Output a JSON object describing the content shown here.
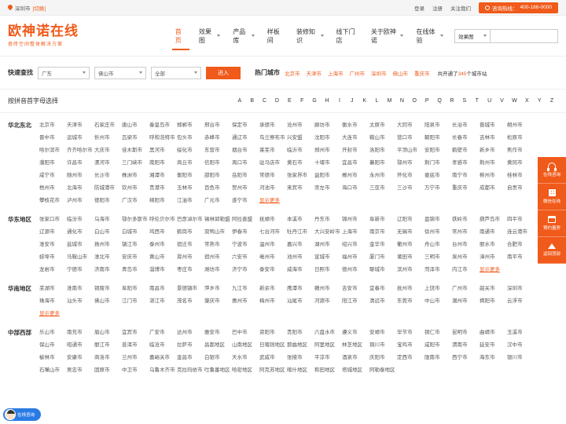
{
  "topbar": {
    "location": "深圳市",
    "switch": "[切换]",
    "login": "登录",
    "register": "注册",
    "follow": "关注我们",
    "hotline_label": "咨询热线：",
    "hotline_number": "400-186-0000"
  },
  "logo": {
    "main": "欧神诺在线",
    "sub": "瓷砖空间整体解决方案"
  },
  "nav": {
    "items": [
      {
        "label": "首页"
      },
      {
        "label": "效果图"
      },
      {
        "label": "产品库"
      },
      {
        "label": "样板间"
      },
      {
        "label": "装修知识"
      },
      {
        "label": "线下门店"
      },
      {
        "label": "关于欧神诺"
      },
      {
        "label": "在线体验"
      }
    ],
    "search_select": "效果图"
  },
  "quick": {
    "label": "快速查找",
    "province": "广东",
    "city": "佛山市",
    "district": "全部",
    "enter": "进入",
    "hot_title": "热门城市",
    "hot_cities": [
      "北京市",
      "天津市",
      "上海市",
      "广州市",
      "深圳市",
      "佛山市",
      "重庆市"
    ],
    "count_prefix": "共开通了",
    "count_num": "345",
    "count_suffix": "个城市站"
  },
  "letters": {
    "label": "按拼音首字母选择",
    "list": [
      "A",
      "B",
      "C",
      "D",
      "E",
      "F",
      "G",
      "H",
      "I",
      "J",
      "K",
      "L",
      "M",
      "N",
      "O",
      "P",
      "Q",
      "R",
      "S",
      "T",
      "U",
      "V",
      "W",
      "X",
      "Y",
      "Z"
    ]
  },
  "regions": [
    {
      "name": "华北东北",
      "cities": [
        "北京市",
        "天津市",
        "石家庄市",
        "唐山市",
        "秦皇岛市",
        "邯郸市",
        "邢台市",
        "保定市",
        "承德市",
        "沧州市",
        "廊坊市",
        "衡水市",
        "太原市",
        "大同市",
        "阳泉市",
        "长治市",
        "晋城市",
        "朔州市",
        "晋中市",
        "运城市",
        "忻州市",
        "吕梁市",
        "呼和浩特市",
        "包头市",
        "赤峰市",
        "通辽市",
        "鸟兰察布市",
        "兴安盟",
        "沈阳市",
        "大连市",
        "鞍山市",
        "营口市",
        "朝阳市",
        "长春市",
        "吉林市",
        "松原市",
        "哈尔滨市",
        "齐齐哈尔市",
        "大庆市",
        "佳木斯市",
        "黑河市",
        "绥化市",
        "东营市",
        "烟台市",
        "莱芜市",
        "临沂市",
        "郑州市",
        "开封市",
        "洛阳市",
        "平顶山市",
        "安阳市",
        "鹤壁市",
        "新乡市",
        "焦作市",
        "濮阳市",
        "许昌市",
        "漯河市",
        "三门峡市",
        "南阳市",
        "商丘市",
        "信阳市",
        "周口市",
        "驻马店市",
        "黄石市",
        "十堰市",
        "宜昌市",
        "襄阳市",
        "鄂州市",
        "荆门市",
        "孝感市",
        "荆州市",
        "黄冈市",
        "咸宁市",
        "随州市",
        "长沙市",
        "株洲市",
        "湘潭市",
        "衡阳市",
        "邵阳市",
        "岳阳市",
        "常德市",
        "张家界市",
        "益阳市",
        "郴州市",
        "永州市",
        "怀化市",
        "娄底市",
        "南宁市",
        "柳州市",
        "桂林市",
        "梧州市",
        "北海市",
        "防城港市",
        "钦州市",
        "贵港市",
        "玉林市",
        "百色市",
        "贺州市",
        "河池市",
        "来宾市",
        "崇左市",
        "海口市",
        "三亚市",
        "三沙市",
        "万宁市",
        "重庆市",
        "成都市",
        "自贡市",
        "攀枝花市",
        "泸州市",
        "德阳市",
        "广汉市",
        "绵阳市",
        "江油市",
        "广元市",
        "遂宁市"
      ],
      "more": "显示更多"
    },
    {
      "name": "华东地区",
      "cities": [
        "张家口市",
        "临汾市",
        "乌海市",
        "鄂尔多斯市",
        "呼伦贝尔市",
        "巴彦淖尔市",
        "锡林郭勒盟",
        "阿拉善盟",
        "抚顺市",
        "本溪市",
        "丹东市",
        "锦州市",
        "阜新市",
        "辽阳市",
        "盘锦市",
        "铁岭市",
        "葫芦岛市",
        "四平市",
        "辽源市",
        "通化市",
        "白山市",
        "白城市",
        "鸡西市",
        "鹤岗市",
        "双鸭山市",
        "伊春市",
        "七台河市",
        "牡丹江市",
        "大兴安岭市",
        "上海市",
        "南京市",
        "无锡市",
        "徐州市",
        "常州市",
        "南通市",
        "连云港市",
        "淮安市",
        "盐城市",
        "扬州市",
        "镇江市",
        "泰州市",
        "宿迁市",
        "常熟市",
        "宁波市",
        "温州市",
        "嘉兴市",
        "湖州市",
        "绍兴市",
        "金华市",
        "衢州市",
        "舟山市",
        "台州市",
        "丽水市",
        "合肥市",
        "蚌埠市",
        "马鞍山市",
        "淮北市",
        "安庆市",
        "黄山市",
        "滁州市",
        "宿州市",
        "六安市",
        "亳州市",
        "池州市",
        "宣城市",
        "福州市",
        "厦门市",
        "莆田市",
        "三明市",
        "泉州市",
        "漳州市",
        "南平市",
        "龙岩市",
        "宁德市",
        "济南市",
        "青岛市",
        "淄博市",
        "枣庄市",
        "潍坊市",
        "济宁市",
        "泰安市",
        "威海市",
        "日照市",
        "德州市",
        "聊城市",
        "滨州市",
        "菏泽市",
        "内江市"
      ],
      "more": "显示更多"
    },
    {
      "name": "华南地区",
      "cities": [
        "芜湖市",
        "淮南市",
        "铜陵市",
        "阜阳市",
        "南昌市",
        "景德镇市",
        "萍乡市",
        "九江市",
        "新余市",
        "鹰潭市",
        "赣州市",
        "吉安市",
        "宜春市",
        "抚州市",
        "上饶市",
        "广州市",
        "韶关市",
        "深圳市",
        "珠海市",
        "汕头市",
        "佛山市",
        "江门市",
        "湛江市",
        "茂名市",
        "肇庆市",
        "惠州市",
        "梅州市",
        "汕尾市",
        "河源市",
        "阳江市",
        "清远市",
        "东莞市",
        "中山市",
        "潮州市",
        "揭阳市",
        "云浮市"
      ],
      "more": "显示更多"
    },
    {
      "name": "中部西部",
      "cities": [
        "乐山市",
        "南充市",
        "眉山市",
        "宜宾市",
        "广安市",
        "达州市",
        "雅安市",
        "巴中市",
        "资阳市",
        "贵阳市",
        "六盘水市",
        "遵义市",
        "安顺市",
        "毕节市",
        "铜仁市",
        "昆明市",
        "曲靖市",
        "玉溪市",
        "保山市",
        "昭通市",
        "丽江市",
        "普洱市",
        "临沧市",
        "拉萨市",
        "昌都地区",
        "山南地区",
        "日喀则地区",
        "那曲地区",
        "阿里地区",
        "林芝地区",
        "铜川市",
        "宝鸡市",
        "咸阳市",
        "渭南市",
        "延安市",
        "汉中市",
        "榆林市",
        "安康市",
        "商洛市",
        "兰州市",
        "嘉峪关市",
        "金昌市",
        "白银市",
        "天水市",
        "武威市",
        "张掖市",
        "平凉市",
        "酒泉市",
        "庆阳市",
        "定西市",
        "陇南市",
        "西宁市",
        "海东市",
        "银川市",
        "石嘴山市",
        "吴忠市",
        "固原市",
        "中卫市",
        "乌鲁木齐市",
        "克拉玛依市",
        "吐鲁番地区",
        "哈密地区",
        "阿克苏地区",
        "喀什地区",
        "和田地区",
        "塔城地区",
        "阿勒泰地区"
      ]
    }
  ],
  "side": {
    "consult": "在线咨询",
    "wechat": "微信在线",
    "booking": "预约量房",
    "top": "返回顶部"
  },
  "chat": {
    "label": "在线咨询"
  }
}
